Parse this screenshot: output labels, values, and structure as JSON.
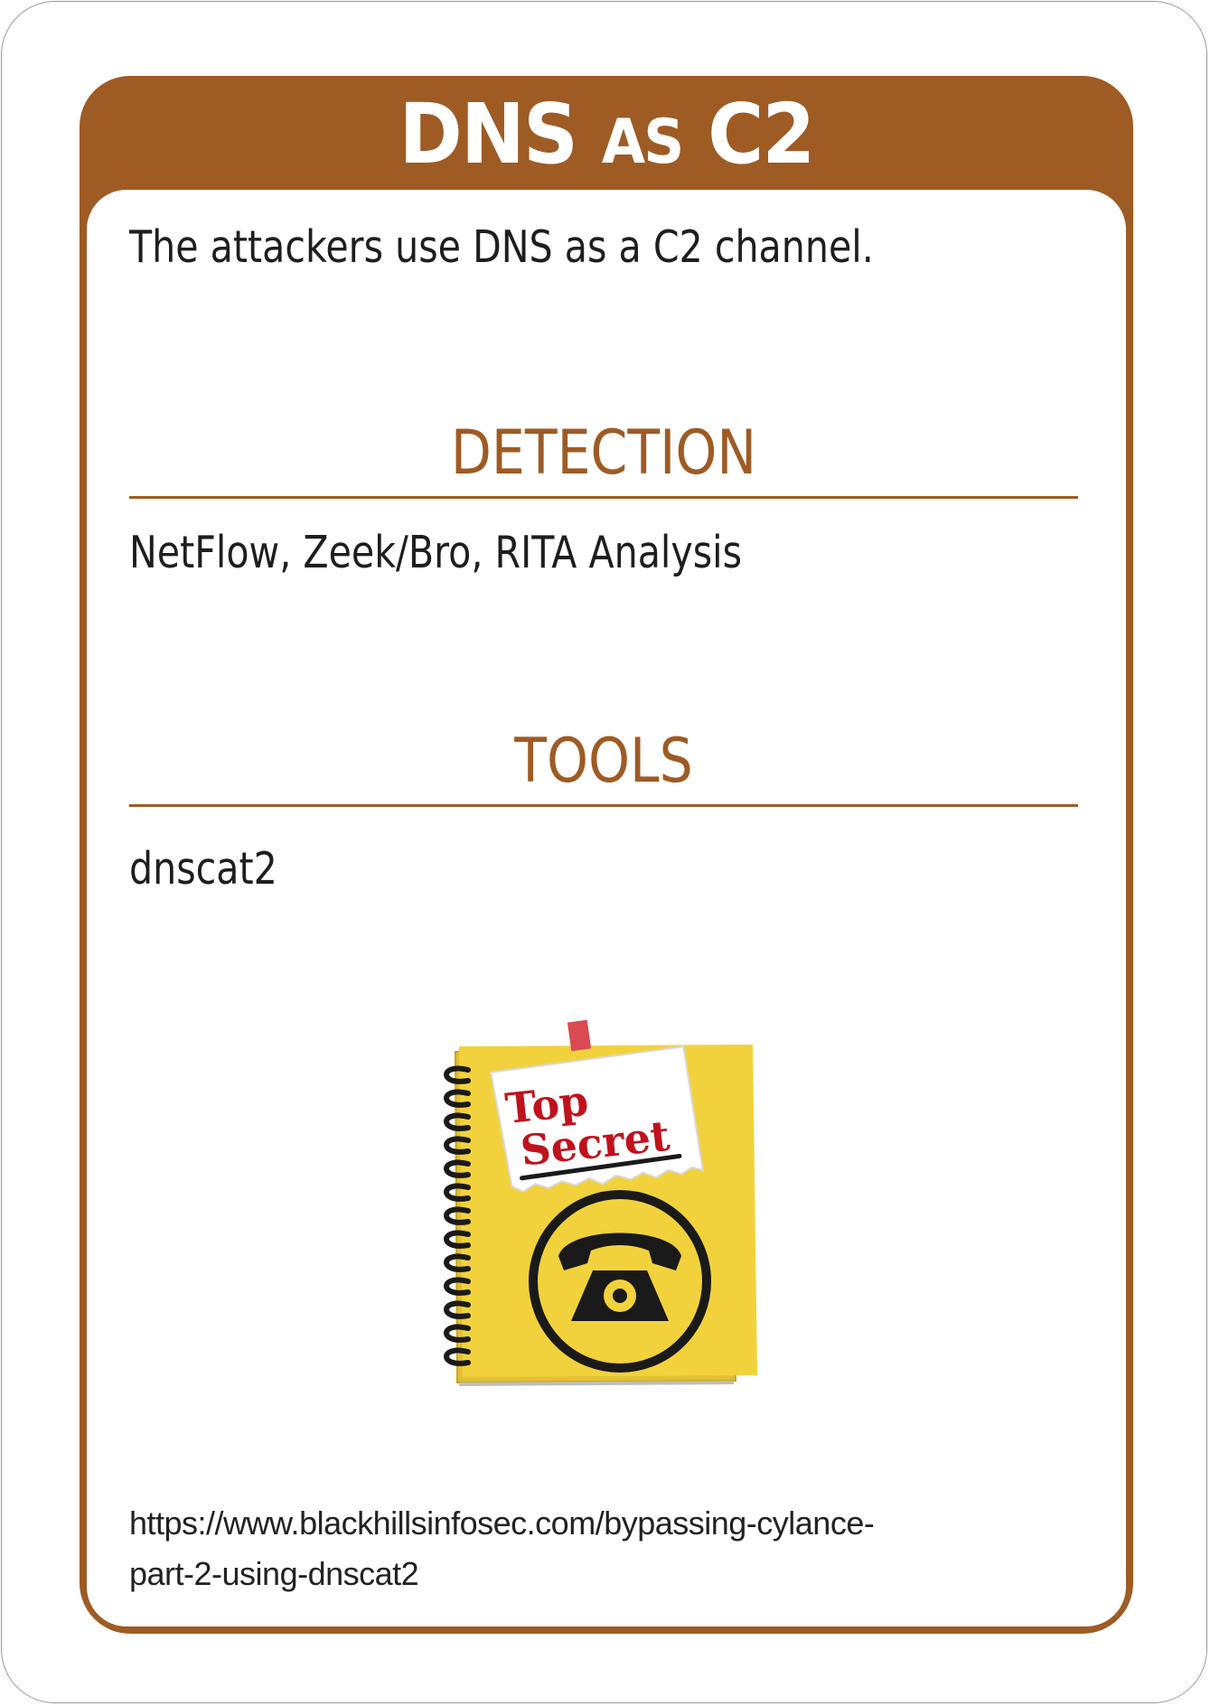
{
  "card": {
    "title_main": "DNS ",
    "title_small": "AS",
    "title_end": " C2",
    "description": "The attackers use DNS as a C2 channel.",
    "detection": {
      "heading": "DETECTION",
      "text": "NetFlow, Zeek/Bro, RITA Analysis"
    },
    "tools": {
      "heading": "TOOLS",
      "text": "dnscat2"
    },
    "illustration": {
      "icon": "top-secret-notebook-telephone-icon",
      "note_line1": "Top",
      "note_line2": "Secret"
    },
    "reference": {
      "line1": "https://www.blackhillsinfosec.com/bypassing-cylance-",
      "line2": "part-2-using-dnscat2"
    }
  },
  "colors": {
    "frame": "#9e5b24",
    "notebook": "#f2d23c",
    "note_text": "#c0121c"
  }
}
